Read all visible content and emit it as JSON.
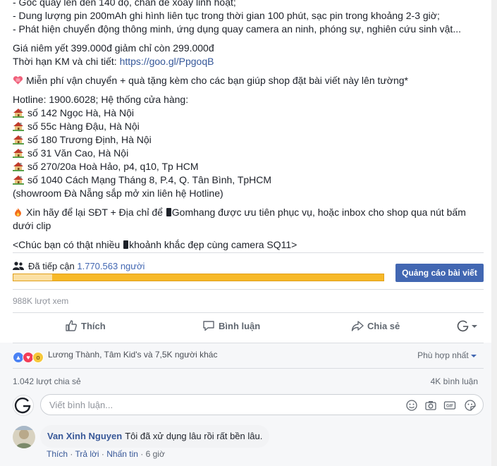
{
  "post": {
    "lines": {
      "l1": "- Góc quay lên đến 140 độ, chân đế xoay linh hoạt;",
      "l2": "- Dung lượng pin 200mAh ghi hình liên tục trong thời gian 100 phút, sạc pin trong khoảng 2-3 giờ;",
      "l3": "- Phát hiện chuyển động thông minh, ứng dụng quay camera an ninh, phóng sự, nghiên cứu sinh vật...",
      "price": "Giá niêm yết 399.000đ giảm chỉ còn 299.000đ",
      "promo_prefix": "Thời hạn KM và chi tiết: ",
      "promo_link": "https://goo.gl/PpgoqB",
      "free_ship": "Miễn phí vận chuyển + quà tặng kèm cho các bạn giúp shop đặt bài viết này lên tường*",
      "hotline": "Hotline: 1900.6028; Hệ thống cửa hàng:",
      "showroom": "(showroom Đà Nẵng sắp mở xin liên hệ Hotline)",
      "cta_a": "Xin hãy để lại SĐT + Địa chỉ để ",
      "cta_b": "Gomhang được ưu tiên phục vụ, hoặc inbox cho shop qua nút bấm",
      "cta_c": "dưới clip",
      "wish_a": "<Chúc bạn có thật nhiều ",
      "wish_b": "khoảnh khắc đẹp cùng camera SQ11>"
    },
    "stores": [
      "số 142 Ngọc Hà, Hà Nội",
      "số 55c Hàng Đậu, Hà Nội",
      "số 180 Trương Định, Hà Nội",
      "số 31 Văn Cao, Hà Nội",
      "số 270/20a Hoà Hảo, p4, q10, Tp HCM",
      "số 1040 Cách Mạng Tháng 8, P.4, Q. Tân Bình, TpHCM"
    ]
  },
  "reach": {
    "label": "Đã tiếp cận ",
    "count": "1.770.563 người",
    "organic_fraction": 0.105,
    "boost_button": "Quảng cáo bài viết"
  },
  "views": "988K lượt xem",
  "actions": {
    "like": "Thích",
    "comment": "Bình luận",
    "share": "Chia sẻ"
  },
  "reactions": {
    "names": "Lương Thành, Tâm Kid's và 7,5K người khác",
    "sort": "Phù hợp nhất"
  },
  "shares": "1.042 lượt chia sẻ",
  "comments_count": "4K bình luận",
  "comment_input": {
    "placeholder": "Viết bình luận..."
  },
  "comment": {
    "author": "Van Xinh Nguyen",
    "text": "Tôi đã xử dụng lâu rồi rất bền lâu.",
    "like": "Thích",
    "reply": "Trả lời",
    "translate": "Nhấn tin",
    "time": "6 giờ"
  },
  "colors": {
    "accent": "#4267b2",
    "bar": "#f7b928",
    "link": "#365899"
  }
}
